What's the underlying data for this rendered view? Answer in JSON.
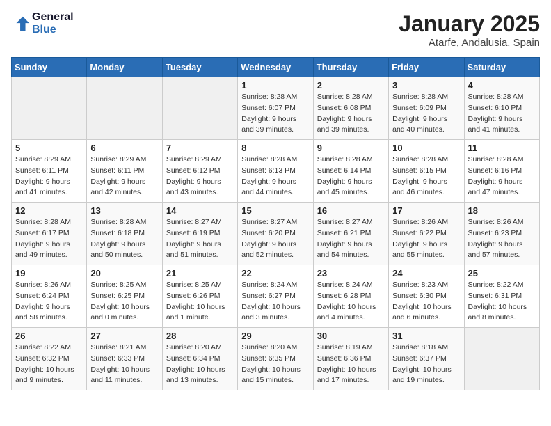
{
  "logo": {
    "line1": "General",
    "line2": "Blue"
  },
  "title": "January 2025",
  "location": "Atarfe, Andalusia, Spain",
  "weekdays": [
    "Sunday",
    "Monday",
    "Tuesday",
    "Wednesday",
    "Thursday",
    "Friday",
    "Saturday"
  ],
  "weeks": [
    [
      {
        "day": "",
        "info": ""
      },
      {
        "day": "",
        "info": ""
      },
      {
        "day": "",
        "info": ""
      },
      {
        "day": "1",
        "info": "Sunrise: 8:28 AM\nSunset: 6:07 PM\nDaylight: 9 hours\nand 39 minutes."
      },
      {
        "day": "2",
        "info": "Sunrise: 8:28 AM\nSunset: 6:08 PM\nDaylight: 9 hours\nand 39 minutes."
      },
      {
        "day": "3",
        "info": "Sunrise: 8:28 AM\nSunset: 6:09 PM\nDaylight: 9 hours\nand 40 minutes."
      },
      {
        "day": "4",
        "info": "Sunrise: 8:28 AM\nSunset: 6:10 PM\nDaylight: 9 hours\nand 41 minutes."
      }
    ],
    [
      {
        "day": "5",
        "info": "Sunrise: 8:29 AM\nSunset: 6:11 PM\nDaylight: 9 hours\nand 41 minutes."
      },
      {
        "day": "6",
        "info": "Sunrise: 8:29 AM\nSunset: 6:11 PM\nDaylight: 9 hours\nand 42 minutes."
      },
      {
        "day": "7",
        "info": "Sunrise: 8:29 AM\nSunset: 6:12 PM\nDaylight: 9 hours\nand 43 minutes."
      },
      {
        "day": "8",
        "info": "Sunrise: 8:28 AM\nSunset: 6:13 PM\nDaylight: 9 hours\nand 44 minutes."
      },
      {
        "day": "9",
        "info": "Sunrise: 8:28 AM\nSunset: 6:14 PM\nDaylight: 9 hours\nand 45 minutes."
      },
      {
        "day": "10",
        "info": "Sunrise: 8:28 AM\nSunset: 6:15 PM\nDaylight: 9 hours\nand 46 minutes."
      },
      {
        "day": "11",
        "info": "Sunrise: 8:28 AM\nSunset: 6:16 PM\nDaylight: 9 hours\nand 47 minutes."
      }
    ],
    [
      {
        "day": "12",
        "info": "Sunrise: 8:28 AM\nSunset: 6:17 PM\nDaylight: 9 hours\nand 49 minutes."
      },
      {
        "day": "13",
        "info": "Sunrise: 8:28 AM\nSunset: 6:18 PM\nDaylight: 9 hours\nand 50 minutes."
      },
      {
        "day": "14",
        "info": "Sunrise: 8:27 AM\nSunset: 6:19 PM\nDaylight: 9 hours\nand 51 minutes."
      },
      {
        "day": "15",
        "info": "Sunrise: 8:27 AM\nSunset: 6:20 PM\nDaylight: 9 hours\nand 52 minutes."
      },
      {
        "day": "16",
        "info": "Sunrise: 8:27 AM\nSunset: 6:21 PM\nDaylight: 9 hours\nand 54 minutes."
      },
      {
        "day": "17",
        "info": "Sunrise: 8:26 AM\nSunset: 6:22 PM\nDaylight: 9 hours\nand 55 minutes."
      },
      {
        "day": "18",
        "info": "Sunrise: 8:26 AM\nSunset: 6:23 PM\nDaylight: 9 hours\nand 57 minutes."
      }
    ],
    [
      {
        "day": "19",
        "info": "Sunrise: 8:26 AM\nSunset: 6:24 PM\nDaylight: 9 hours\nand 58 minutes."
      },
      {
        "day": "20",
        "info": "Sunrise: 8:25 AM\nSunset: 6:25 PM\nDaylight: 10 hours\nand 0 minutes."
      },
      {
        "day": "21",
        "info": "Sunrise: 8:25 AM\nSunset: 6:26 PM\nDaylight: 10 hours\nand 1 minute."
      },
      {
        "day": "22",
        "info": "Sunrise: 8:24 AM\nSunset: 6:27 PM\nDaylight: 10 hours\nand 3 minutes."
      },
      {
        "day": "23",
        "info": "Sunrise: 8:24 AM\nSunset: 6:28 PM\nDaylight: 10 hours\nand 4 minutes."
      },
      {
        "day": "24",
        "info": "Sunrise: 8:23 AM\nSunset: 6:30 PM\nDaylight: 10 hours\nand 6 minutes."
      },
      {
        "day": "25",
        "info": "Sunrise: 8:22 AM\nSunset: 6:31 PM\nDaylight: 10 hours\nand 8 minutes."
      }
    ],
    [
      {
        "day": "26",
        "info": "Sunrise: 8:22 AM\nSunset: 6:32 PM\nDaylight: 10 hours\nand 9 minutes."
      },
      {
        "day": "27",
        "info": "Sunrise: 8:21 AM\nSunset: 6:33 PM\nDaylight: 10 hours\nand 11 minutes."
      },
      {
        "day": "28",
        "info": "Sunrise: 8:20 AM\nSunset: 6:34 PM\nDaylight: 10 hours\nand 13 minutes."
      },
      {
        "day": "29",
        "info": "Sunrise: 8:20 AM\nSunset: 6:35 PM\nDaylight: 10 hours\nand 15 minutes."
      },
      {
        "day": "30",
        "info": "Sunrise: 8:19 AM\nSunset: 6:36 PM\nDaylight: 10 hours\nand 17 minutes."
      },
      {
        "day": "31",
        "info": "Sunrise: 8:18 AM\nSunset: 6:37 PM\nDaylight: 10 hours\nand 19 minutes."
      },
      {
        "day": "",
        "info": ""
      }
    ]
  ]
}
